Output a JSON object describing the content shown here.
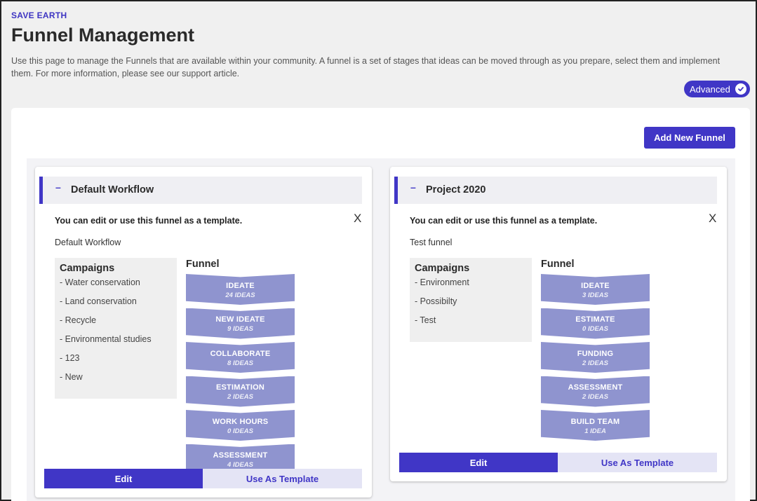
{
  "community": "SAVE EARTH",
  "title": "Funnel Management",
  "description": "Use this page to manage the Funnels that are available within your community. A funnel is a set of stages that ideas can be moved through as you prepare, select them and implement them. For more information, please see our support article.",
  "advanced_label": "Advanced",
  "add_button": "Add New Funnel",
  "funnels": [
    {
      "name": "Default Workflow",
      "note": "You can edit or use this funnel as a template.",
      "close": "X",
      "description": "Default Workflow",
      "campaigns_title": "Campaigns",
      "campaigns": [
        "- Water conservation",
        "- Land conservation",
        "- Recycle",
        "- Environmental studies",
        "- 123",
        "- New"
      ],
      "funnel_title": "Funnel",
      "stages": [
        {
          "name": "IDEATE",
          "count": "24 IDEAS"
        },
        {
          "name": "NEW IDEATE",
          "count": "9 IDEAS"
        },
        {
          "name": "COLLABORATE",
          "count": "8 IDEAS"
        },
        {
          "name": "ESTIMATION",
          "count": "2 IDEAS"
        },
        {
          "name": "WORK HOURS",
          "count": "0 IDEAS"
        },
        {
          "name": "ASSESSMENT",
          "count": "4 IDEAS"
        }
      ],
      "edit": "Edit",
      "use_template": "Use As Template"
    },
    {
      "name": "Project 2020",
      "note": "You can edit or use this funnel as a template.",
      "close": "X",
      "description": "Test funnel",
      "campaigns_title": "Campaigns",
      "campaigns": [
        "- Environment",
        "- Possibilty",
        "- Test"
      ],
      "funnel_title": "Funnel",
      "stages": [
        {
          "name": "IDEATE",
          "count": "3 IDEAS"
        },
        {
          "name": "ESTIMATE",
          "count": "0 IDEAS"
        },
        {
          "name": "FUNDING",
          "count": "2 IDEAS"
        },
        {
          "name": "ASSESSMENT",
          "count": "2 IDEAS"
        },
        {
          "name": "BUILD TEAM",
          "count": "1 IDEA"
        }
      ],
      "edit": "Edit",
      "use_template": "Use As Template"
    }
  ]
}
